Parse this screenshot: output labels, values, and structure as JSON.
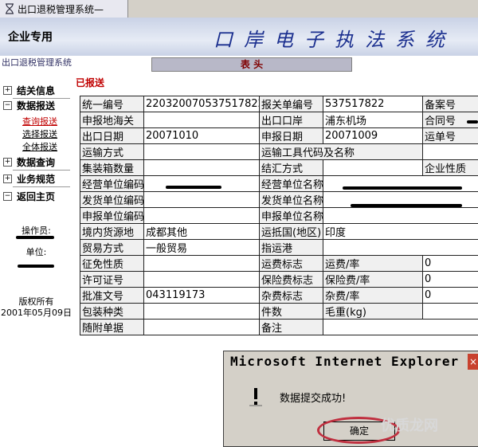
{
  "browser": {
    "tab_title": "出口退税管理系统—"
  },
  "header": {
    "company_label": "企业专用",
    "system_title": "口岸电子执法系统"
  },
  "sidebar": {
    "app_name": "出口退税管理系统",
    "nav": [
      {
        "label": "结关信息",
        "toggle": "+"
      },
      {
        "label": "数据报送",
        "toggle": "−"
      },
      {
        "label": "数据查询",
        "toggle": "+"
      },
      {
        "label": "业务规范",
        "toggle": "+"
      },
      {
        "label": "返回主页",
        "toggle": "−"
      }
    ],
    "sub_items": [
      "查询报送",
      "选择报送",
      "全体报送"
    ],
    "operator_label": "操作员:",
    "unit_label": "单位:",
    "copyright_line1": "版权所有",
    "copyright_line2": "2001年05月09日"
  },
  "main": {
    "section_title": "表 头",
    "status": "已报送",
    "fields": {
      "tongyi_bianhao": {
        "label": "统一编号",
        "value": "220320070537517822"
      },
      "baoguandan": {
        "label": "报关单编号",
        "value": "537517822"
      },
      "beian": {
        "label": "备案号"
      },
      "shenbao_haiguan": {
        "label": "申报地海关"
      },
      "chukou_kouan": {
        "label": "出口口岸",
        "value": "浦东机场"
      },
      "hetong": {
        "label": "合同号"
      },
      "chukou_riqi": {
        "label": "出口日期",
        "value": "20071010"
      },
      "shenbao_riqi": {
        "label": "申报日期",
        "value": "20071009"
      },
      "yundan": {
        "label": "运单号"
      },
      "yunshu_fangshi": {
        "label": "运输方式"
      },
      "yunshu_gongju": {
        "label": "运输工具代码及名称"
      },
      "jizhuangxiang": {
        "label": "集装箱数量"
      },
      "jiehui": {
        "label": "结汇方式"
      },
      "qiye_xingzhi": {
        "label": "企业性质"
      },
      "jingying_bianma": {
        "label": "经营单位编码"
      },
      "jingying_mingcheng": {
        "label": "经营单位名称"
      },
      "fahuo_bianma": {
        "label": "发货单位编码"
      },
      "fahuo_mingcheng": {
        "label": "发货单位名称"
      },
      "shenbao_bianma": {
        "label": "申报单位编码"
      },
      "shenbao_mingcheng": {
        "label": "申报单位名称"
      },
      "jingnei_huoyuan": {
        "label": "境内货源地",
        "value": "成都其他"
      },
      "yundiguo": {
        "label": "运抵国(地区)",
        "value": "印度"
      },
      "maoyi_fangshi": {
        "label": "贸易方式",
        "value": "一般贸易"
      },
      "zhiyungang": {
        "label": "指运港"
      },
      "zhengmian": {
        "label": "征免性质"
      },
      "yunfei_biaozhi": {
        "label": "运费标志"
      },
      "yunfei_lv": {
        "label": "运费/率",
        "value": "0"
      },
      "xuke": {
        "label": "许可证号"
      },
      "baoxian_biaozhi": {
        "label": "保险费标志"
      },
      "baoxian_lv": {
        "label": "保险费/率",
        "value": "0"
      },
      "pizhun": {
        "label": "批准文号",
        "value": "043119173"
      },
      "zafei_biaozhi": {
        "label": "杂费标志"
      },
      "zafei_lv": {
        "label": "杂费/率",
        "value": "0"
      },
      "baozhuang": {
        "label": "包装种类"
      },
      "jianshu": {
        "label": "件数"
      },
      "maozhong": {
        "label": "毛重(kg)"
      },
      "suifu_dande": {
        "label": "随附单据"
      },
      "beizhu": {
        "label": "备注"
      }
    }
  },
  "dialog": {
    "title": "Microsoft Internet Explorer",
    "close_glyph": "×",
    "message": "数据提交成功!",
    "ok_label": "确定"
  },
  "watermark": "优质龙网"
}
